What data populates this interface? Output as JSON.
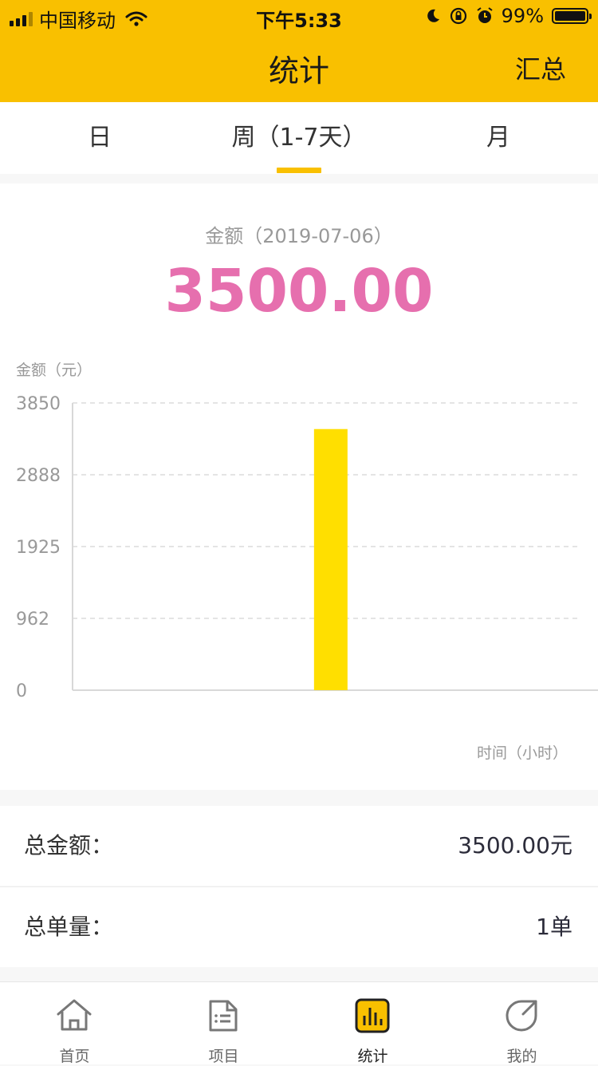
{
  "status_bar": {
    "carrier": "中国移动",
    "time": "下午5:33",
    "battery": "99%",
    "battery_level": 0.99,
    "icons": [
      "signal-icon",
      "wifi-icon",
      "moon-icon",
      "rotation-lock-icon",
      "alarm-icon",
      "battery-icon"
    ]
  },
  "header": {
    "title": "统计",
    "right_action": "汇总"
  },
  "tabs": [
    {
      "label": "日",
      "active": false
    },
    {
      "label": "周（1-7天）",
      "active": true
    },
    {
      "label": "月",
      "active": false
    }
  ],
  "summary_header": {
    "amount_label": "金额（2019-07-06）",
    "amount_value": "3500.00"
  },
  "chart_data": {
    "type": "bar",
    "ylabel": "金额（元）",
    "xlabel": "时间（小时）",
    "ylim": [
      0,
      3850
    ],
    "yticks": [
      0,
      962,
      1925,
      2888,
      3850
    ],
    "categories": [
      "",
      "",
      "",
      "",
      "",
      "",
      ""
    ],
    "values": [
      0,
      0,
      0,
      3500,
      0,
      0,
      0
    ],
    "grid": true,
    "bar_color": "#ffdf00"
  },
  "stats": [
    {
      "key": "总金额：",
      "value": "3500.00元"
    },
    {
      "key": "总单量：",
      "value": "1单"
    }
  ],
  "tabbar": [
    {
      "label": "首页",
      "icon": "home-icon",
      "active": false
    },
    {
      "label": "项目",
      "icon": "folder-list-icon",
      "active": false
    },
    {
      "label": "统计",
      "icon": "bar-chart-icon",
      "active": true
    },
    {
      "label": "我的",
      "icon": "profile-leaf-icon",
      "active": false
    }
  ],
  "colors": {
    "accent": "#f9c000",
    "amount": "#e66fae",
    "bar": "#ffdf00"
  }
}
